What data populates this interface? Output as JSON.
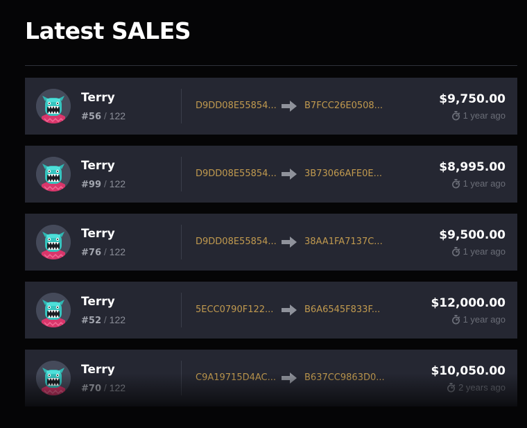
{
  "page": {
    "title": "Latest SALES"
  },
  "colors": {
    "background": "#050506",
    "card": "#252732",
    "address": "#c19a4f",
    "muted": "#8b8e98"
  },
  "icons": {
    "transfer": "arrow-right-icon",
    "time": "stopwatch-icon",
    "avatar": "terry-monster-avatar"
  },
  "sales": [
    {
      "name": "Terry",
      "number": "#56",
      "separator": "/",
      "total": "122",
      "from": "D9DD08E55854...",
      "to": "B7FCC26E0508...",
      "price": "$9,750.00",
      "time": "1 year ago"
    },
    {
      "name": "Terry",
      "number": "#99",
      "separator": "/",
      "total": "122",
      "from": "D9DD08E55854...",
      "to": "3B73066AFE0E...",
      "price": "$8,995.00",
      "time": "1 year ago"
    },
    {
      "name": "Terry",
      "number": "#76",
      "separator": "/",
      "total": "122",
      "from": "D9DD08E55854...",
      "to": "38AA1FA7137C...",
      "price": "$9,500.00",
      "time": "1 year ago"
    },
    {
      "name": "Terry",
      "number": "#52",
      "separator": "/",
      "total": "122",
      "from": "5ECC0790F122...",
      "to": "B6A6545F833F...",
      "price": "$12,000.00",
      "time": "1 year ago"
    },
    {
      "name": "Terry",
      "number": "#70",
      "separator": "/",
      "total": "122",
      "from": "C9A19715D4AC...",
      "to": "B637CC9863D0...",
      "price": "$10,050.00",
      "time": "2 years ago"
    }
  ]
}
